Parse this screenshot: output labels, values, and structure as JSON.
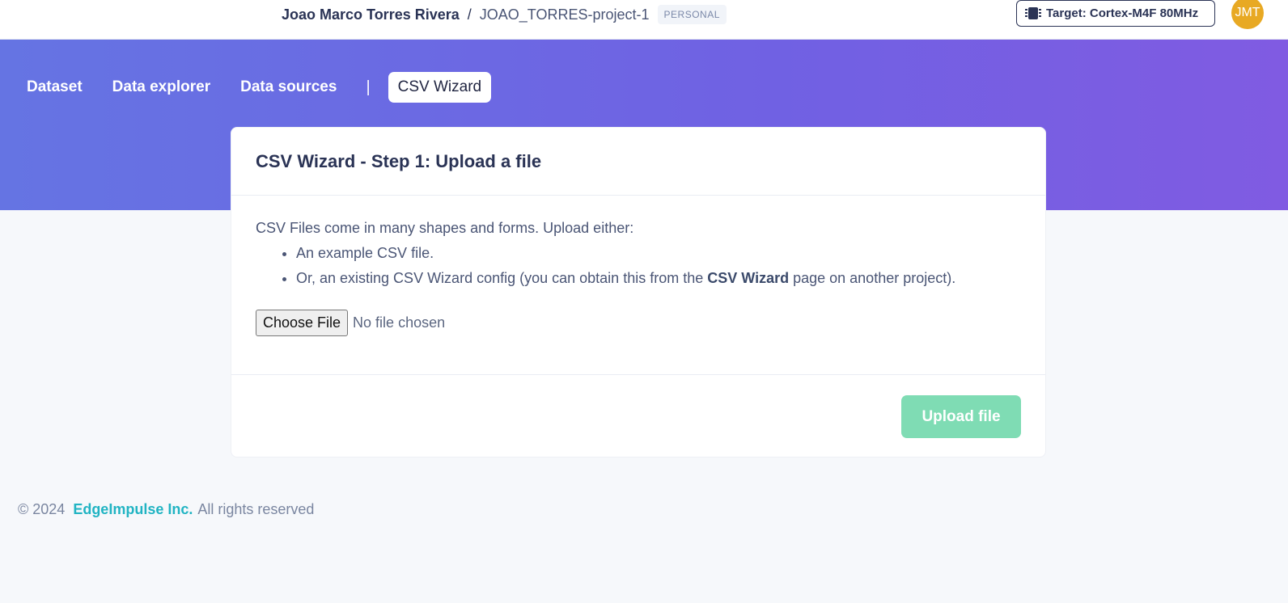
{
  "header": {
    "owner": "Joao Marco Torres Rivera",
    "separator": "/",
    "project": "JOAO_TORRES-project-1",
    "badge": "PERSONAL",
    "target_label": "Target: Cortex-M4F 80MHz",
    "avatar_initials": "JMT",
    "avatar_color": "#e8a923"
  },
  "tabs": [
    {
      "label": "Dataset"
    },
    {
      "label": "Data explorer"
    },
    {
      "label": "Data sources"
    },
    {
      "label": "CSV Wizard",
      "active": true
    }
  ],
  "tab_divider": "|",
  "card": {
    "title": "CSV Wizard - Step 1: Upload a file",
    "intro": "CSV Files come in many shapes and forms. Upload either:",
    "bullet_1": "An example CSV file.",
    "bullet_2_prefix": "Or, an existing CSV Wizard config (you can obtain this from the ",
    "bullet_2_bold": "CSV Wizard",
    "bullet_2_suffix": " page on another project).",
    "choose_file_label": "Choose File",
    "file_status": "No file chosen",
    "upload_label": "Upload file"
  },
  "footer": {
    "copyright": "© 2024",
    "brand": "EdgeImpulse Inc.",
    "rights": "All rights reserved"
  },
  "colors": {
    "gradient_start": "#6574e3",
    "gradient_end": "#805be2",
    "upload_button": "#7fdcb4",
    "brand_link": "#21b4c3"
  }
}
